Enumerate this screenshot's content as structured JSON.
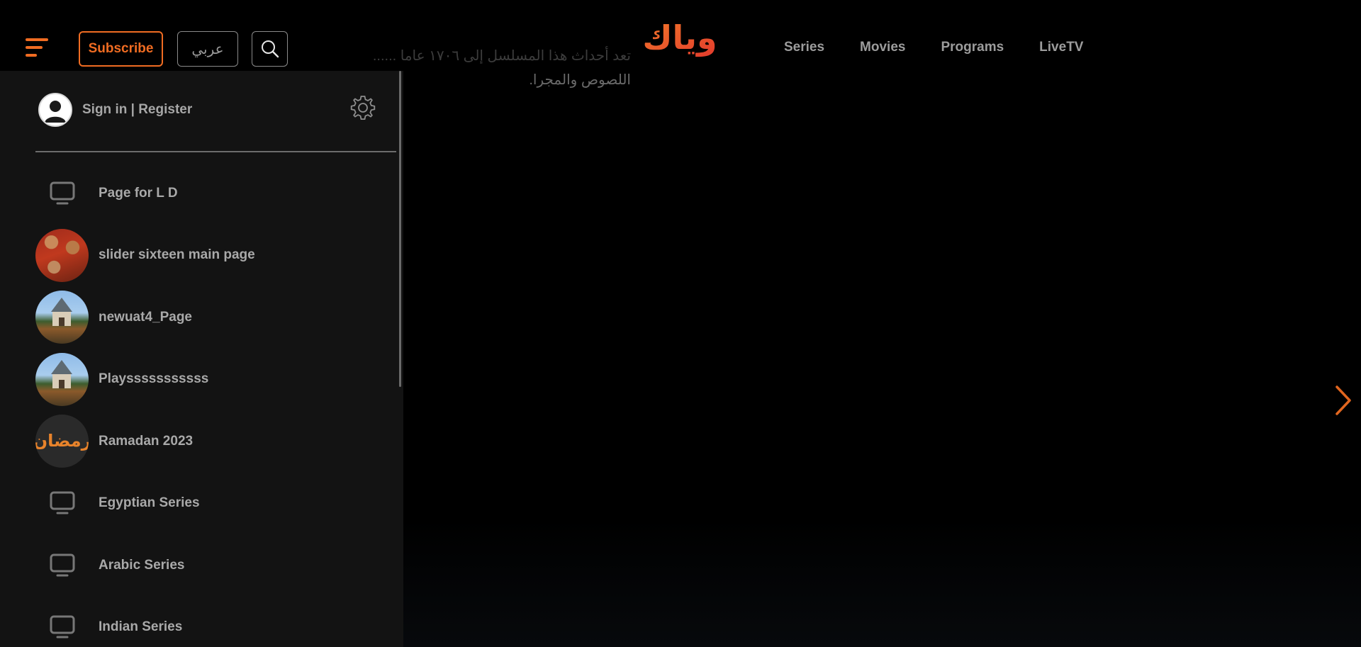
{
  "header": {
    "subscribe_label": "Subscribe",
    "language_label": "عربي",
    "logo_text": "وياك",
    "nav": [
      {
        "label": "Series"
      },
      {
        "label": "Movies"
      },
      {
        "label": "Programs"
      },
      {
        "label": "LiveTV"
      }
    ]
  },
  "hero": {
    "line1": "تعد أحداث هذا المسلسل إلى ١٧٠٦ عاما ......",
    "line2": "اللصوص والمجرا."
  },
  "drawer": {
    "account_label": "Sign in | Register",
    "items": [
      {
        "label": "Page for L D",
        "thumb": "tv-icon"
      },
      {
        "label": "slider sixteen main page",
        "thumb": "people-photo"
      },
      {
        "label": "newuat4_Page",
        "thumb": "castle-photo"
      },
      {
        "label": "Playsssssssssss",
        "thumb": "castle-photo"
      },
      {
        "label": "Ramadan 2023",
        "thumb": "ramadan-logo",
        "thumb_text": "رمضان"
      },
      {
        "label": "Egyptian Series",
        "thumb": "tv-icon"
      },
      {
        "label": "Arabic Series",
        "thumb": "tv-icon"
      },
      {
        "label": "Indian Series",
        "thumb": "tv-icon"
      }
    ]
  },
  "colors": {
    "accent": "#f06c22",
    "drawer_bg": "#131313",
    "text_muted": "#a9a9a9"
  }
}
